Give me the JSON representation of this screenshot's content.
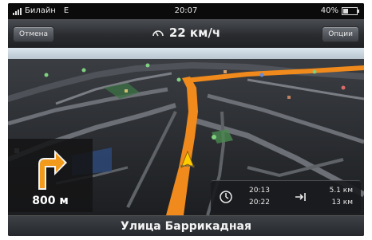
{
  "status_bar": {
    "carrier": "Билайн",
    "network": "E",
    "time": "20:07",
    "battery": "40%",
    "battery_level": 0.4
  },
  "top_bar": {
    "cancel_label": "Отмена",
    "speed": "22 км/ч",
    "options_label": "Опции"
  },
  "maneuver": {
    "distance": "800 м",
    "direction": "turn-right-icon"
  },
  "trip_info": {
    "arrival_time": "20:13",
    "arrival_time_total": "20:22",
    "distance_next": "5.1 км",
    "distance_total": "13 км"
  },
  "street": {
    "name": "Улица Баррикадная"
  },
  "colors": {
    "route": "#f08a1c",
    "background": "#1b1d20",
    "road": "#4a4d52",
    "accent": "#ffcc00"
  }
}
